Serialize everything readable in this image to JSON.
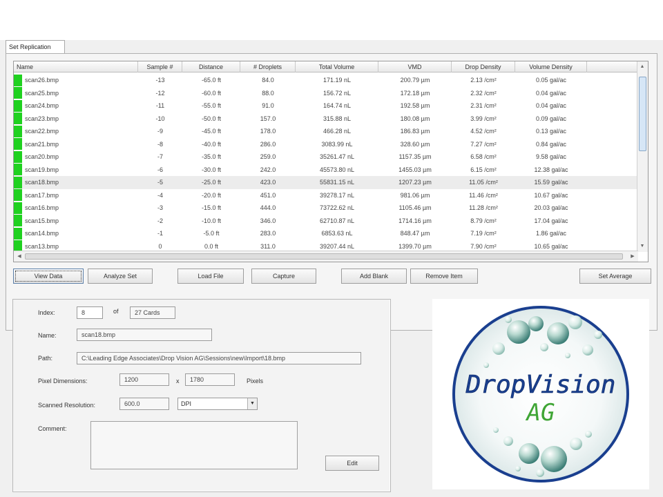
{
  "tab": {
    "label": "Set Replication"
  },
  "table": {
    "columns": [
      "Name",
      "Sample #",
      "Distance",
      "# Droplets",
      "Total Volume",
      "VMD",
      "Drop Density",
      "Volume Density"
    ],
    "rows": [
      [
        "scan26.bmp",
        "-13",
        "-65.0 ft",
        "84.0",
        "171.19 nL",
        "200.79 µm",
        "2.13 /cm²",
        "0.05 gal/ac"
      ],
      [
        "scan25.bmp",
        "-12",
        "-60.0 ft",
        "88.0",
        "156.72 nL",
        "172.18 µm",
        "2.32 /cm²",
        "0.04 gal/ac"
      ],
      [
        "scan24.bmp",
        "-11",
        "-55.0 ft",
        "91.0",
        "164.74 nL",
        "192.58 µm",
        "2.31 /cm²",
        "0.04 gal/ac"
      ],
      [
        "scan23.bmp",
        "-10",
        "-50.0 ft",
        "157.0",
        "315.88 nL",
        "180.08 µm",
        "3.99 /cm²",
        "0.09 gal/ac"
      ],
      [
        "scan22.bmp",
        "-9",
        "-45.0 ft",
        "178.0",
        "466.28 nL",
        "186.83 µm",
        "4.52 /cm²",
        "0.13 gal/ac"
      ],
      [
        "scan21.bmp",
        "-8",
        "-40.0 ft",
        "286.0",
        "3083.99 nL",
        "328.60 µm",
        "7.27 /cm²",
        "0.84 gal/ac"
      ],
      [
        "scan20.bmp",
        "-7",
        "-35.0 ft",
        "259.0",
        "35261.47 nL",
        "1157.35 µm",
        "6.58 /cm²",
        "9.58 gal/ac"
      ],
      [
        "scan19.bmp",
        "-6",
        "-30.0 ft",
        "242.0",
        "45573.80 nL",
        "1455.03 µm",
        "6.15 /cm²",
        "12.38 gal/ac"
      ],
      [
        "scan18.bmp",
        "-5",
        "-25.0 ft",
        "423.0",
        "55831.15 nL",
        "1207.23 µm",
        "11.05 /cm²",
        "15.59 gal/ac"
      ],
      [
        "scan17.bmp",
        "-4",
        "-20.0 ft",
        "451.0",
        "39278.17 nL",
        "981.06 µm",
        "11.46 /cm²",
        "10.67 gal/ac"
      ],
      [
        "scan16.bmp",
        "-3",
        "-15.0 ft",
        "444.0",
        "73722.62 nL",
        "1105.46 µm",
        "11.28 /cm²",
        "20.03 gal/ac"
      ],
      [
        "scan15.bmp",
        "-2",
        "-10.0 ft",
        "346.0",
        "62710.87 nL",
        "1714.16 µm",
        "8.79 /cm²",
        "17.04 gal/ac"
      ],
      [
        "scan14.bmp",
        "-1",
        "-5.0 ft",
        "283.0",
        "6853.63 nL",
        "848.47 µm",
        "7.19 /cm²",
        "1.86 gal/ac"
      ],
      [
        "scan13.bmp",
        "0",
        "0.0 ft",
        "311.0",
        "39207.44 nL",
        "1399.70 µm",
        "7.90 /cm²",
        "10.65 gal/ac"
      ]
    ],
    "selected_index": 8,
    "row_color": "#1fd11f"
  },
  "buttons": {
    "view_data": "View Data",
    "analyze_set": "Analyze Set",
    "load_file": "Load File",
    "capture": "Capture",
    "add_blank": "Add Blank",
    "remove_item": "Remove Item",
    "set_average": "Set Average"
  },
  "details": {
    "index_label": "Index:",
    "index_value": "8",
    "of_label": "of",
    "total_value": "27 Cards",
    "name_label": "Name:",
    "name_value": "scan18.bmp",
    "path_label": "Path:",
    "path_value": "C:\\Leading Edge Associates\\Drop Vision AG\\Sessions\\new\\Import\\18.bmp",
    "pixel_dim_label": "Pixel Dimensions:",
    "pixel_width": "1200",
    "x_label": "x",
    "pixel_height": "1780",
    "pixels_label": "Pixels",
    "resolution_label": "Scanned Resolution:",
    "resolution_value": "600.0",
    "resolution_unit": "DPI",
    "comment_label": "Comment:",
    "edit_button": "Edit"
  },
  "logo": {
    "text_line1": "DropVision",
    "text_line2": "AG",
    "brand_blue": "#1a3f8f",
    "brand_green": "#3fa535"
  }
}
